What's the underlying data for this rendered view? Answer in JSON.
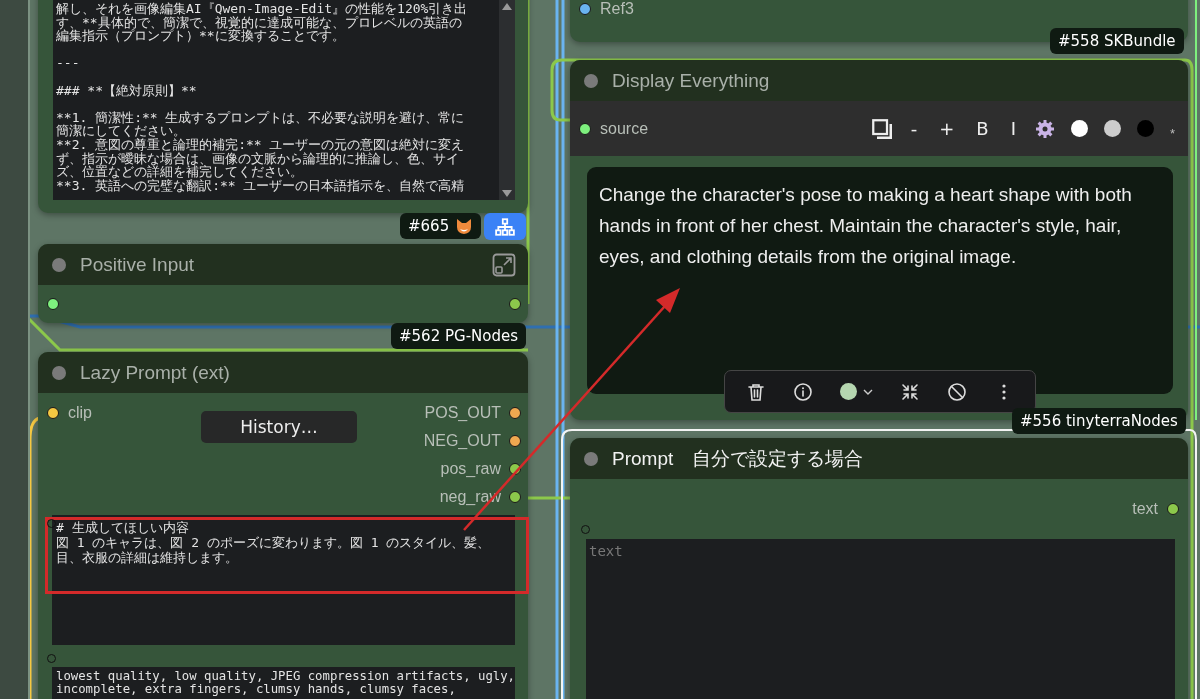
{
  "system_prompt_node": {
    "blocks": [
      {
        "lines": [
          "解し、それを画像編集AI『Qwen-Image-Edit』の性能を120%引き出",
          "す、**具体的で、簡潔で、視覚的に達成可能な、プロレベルの英語の",
          "編集指示（プロンプト）**に変換することです。"
        ]
      },
      {
        "lines": [
          "---"
        ]
      },
      {
        "lines": [
          "### **【絶対原則】**"
        ]
      },
      {
        "lines": [
          "**1. 簡潔性:** 生成するプロンプトは、不必要な説明を避け、常に",
          "簡潔にしてください。",
          "**2. 意図の尊重と論理的補完:** ユーザーの元の意図は絶対に変え",
          "ず、指示が曖昧な場合は、画像の文脈から論理的に推論し、色、サイ",
          "ズ、位置などの詳細を補完してください。",
          "**3. 英語への完璧な翻訳:** ユーザーの日本語指示を、自然で高精"
        ]
      }
    ]
  },
  "badges": [
    {
      "text": "#665",
      "kind": "with_icon"
    },
    {
      "text": "#562 PG-Nodes",
      "kind": "plain"
    },
    {
      "text": "#558 SKBundle",
      "kind": "plain"
    },
    {
      "text": "#556 tinyterraNodes",
      "kind": "plain"
    }
  ],
  "positive_input": {
    "title": "Positive Input",
    "inputs": [
      {
        "color": "#7ef07e"
      }
    ],
    "outputs": [
      {
        "color": "#8cc84b"
      }
    ]
  },
  "lazy_prompt": {
    "title": "Lazy Prompt (ext)",
    "inputs": [
      {
        "label": "clip",
        "color": "#f5c842"
      }
    ],
    "button": "History…",
    "outputs": [
      {
        "label": "POS_OUT",
        "color": "#f0a850"
      },
      {
        "label": "NEG_OUT",
        "color": "#f0a850"
      },
      {
        "label": "pos_raw",
        "color": "#8cc84b"
      },
      {
        "label": "neg_raw",
        "color": "#8cc84b"
      }
    ],
    "prompt_lines": [
      "# 生成してほしい内容",
      "図 1 のキャラは、図 2 のポーズに変わります。図 1 のスタイル、髪、",
      "目、衣服の詳細は維持します。"
    ],
    "negative_lines": [
      "lowest quality, low quality, JPEG compression artifacts, ugly,",
      "incomplete, extra fingers, clumsy hands, clumsy faces,"
    ]
  },
  "ref_node": {
    "inputs": [
      {
        "label": "Ref3",
        "color": "#6ab4f0"
      }
    ]
  },
  "display_everything": {
    "title": "Display Everything",
    "inputs": [
      {
        "label": "source",
        "color": "#7ef07e"
      }
    ],
    "format_buttons": [
      "-",
      "+",
      "B",
      "I"
    ],
    "swatches": [
      {
        "color": "#ffffff"
      },
      {
        "color": "#cccccc"
      },
      {
        "color": "#000000"
      }
    ],
    "marker": "*",
    "output_text": "Change the character's pose to making a heart shape with both hands in front of her chest. Maintain the character's style, hair, eyes, and clothing details from the original image."
  },
  "selection_toolbar": {
    "color": "#b5d6b0"
  },
  "prompt_node": {
    "title": "Prompt　自分で設定する場合",
    "outputs": [
      {
        "label": "text",
        "color": "#8cc84b"
      }
    ],
    "placeholder": "text"
  }
}
